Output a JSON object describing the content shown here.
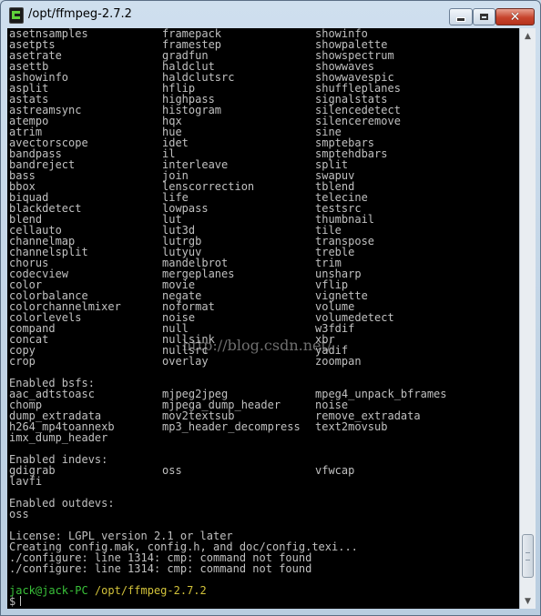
{
  "window": {
    "title": "/opt/ffmpeg-2.7.2",
    "icon": "terminal-app-icon",
    "controls": {
      "minimize": "minimize",
      "maximize": "maximize",
      "close": "close"
    }
  },
  "terminal": {
    "filter_rows": [
      [
        "asetnsamples",
        "framepack",
        "showinfo"
      ],
      [
        "asetpts",
        "framestep",
        "showpalette"
      ],
      [
        "asetrate",
        "gradfun",
        "showspectrum"
      ],
      [
        "asettb",
        "haldclut",
        "showwaves"
      ],
      [
        "ashowinfo",
        "haldclutsrc",
        "showwavespic"
      ],
      [
        "asplit",
        "hflip",
        "shuffleplanes"
      ],
      [
        "astats",
        "highpass",
        "signalstats"
      ],
      [
        "astreamsync",
        "histogram",
        "silencedetect"
      ],
      [
        "atempo",
        "hqx",
        "silenceremove"
      ],
      [
        "atrim",
        "hue",
        "sine"
      ],
      [
        "avectorscope",
        "idet",
        "smptebars"
      ],
      [
        "bandpass",
        "il",
        "smptehdbars"
      ],
      [
        "bandreject",
        "interleave",
        "split"
      ],
      [
        "bass",
        "join",
        "swapuv"
      ],
      [
        "bbox",
        "lenscorrection",
        "tblend"
      ],
      [
        "biquad",
        "life",
        "telecine"
      ],
      [
        "blackdetect",
        "lowpass",
        "testsrc"
      ],
      [
        "blend",
        "lut",
        "thumbnail"
      ],
      [
        "cellauto",
        "lut3d",
        "tile"
      ],
      [
        "channelmap",
        "lutrgb",
        "transpose"
      ],
      [
        "channelsplit",
        "lutyuv",
        "treble"
      ],
      [
        "chorus",
        "mandelbrot",
        "trim"
      ],
      [
        "codecview",
        "mergeplanes",
        "unsharp"
      ],
      [
        "color",
        "movie",
        "vflip"
      ],
      [
        "colorbalance",
        "negate",
        "vignette"
      ],
      [
        "colorchannelmixer",
        "noformat",
        "volume"
      ],
      [
        "colorlevels",
        "noise",
        "volumedetect"
      ],
      [
        "compand",
        "null",
        "w3fdif"
      ],
      [
        "concat",
        "nullsink",
        "xbr"
      ],
      [
        "copy",
        "nullsrc",
        "yadif"
      ],
      [
        "crop",
        "overlay",
        "zoompan"
      ]
    ],
    "bsfs_header": "Enabled bsfs:",
    "bsfs_rows": [
      [
        "aac_adtstoasc",
        "mjpeg2jpeg",
        "mpeg4_unpack_bframes"
      ],
      [
        "chomp",
        "mjpega_dump_header",
        "noise"
      ],
      [
        "dump_extradata",
        "mov2textsub",
        "remove_extradata"
      ],
      [
        "h264_mp4toannexb",
        "mp3_header_decompress",
        "text2movsub"
      ],
      [
        "imx_dump_header",
        "",
        ""
      ]
    ],
    "indevs_header": "Enabled indevs:",
    "indevs_rows": [
      [
        "gdigrab",
        "oss",
        "vfwcap"
      ],
      [
        "lavfi",
        "",
        ""
      ]
    ],
    "outdevs_header": "Enabled outdevs:",
    "outdevs_rows": [
      [
        "oss",
        "",
        ""
      ]
    ],
    "license": "License: LGPL version 2.1 or later",
    "creating": "Creating config.mak, config.h, and doc/config.texi...",
    "errors": [
      "./configure: line 1314: cmp: command not found",
      "./configure: line 1314: cmp: command not found"
    ],
    "prompt_user": "jack@jack-PC",
    "prompt_path": "/opt/ffmpeg-2.7.2",
    "prompt_symbol": "$"
  },
  "watermark": "http://blog.csdn.net/",
  "scrollbar": {
    "position": 0.97,
    "visible_fraction": 0.08
  },
  "colors": {
    "terminal_bg": "#000000",
    "text": "#c0c0c0",
    "prompt_user": "#39c139",
    "prompt_path": "#d2c23a"
  }
}
